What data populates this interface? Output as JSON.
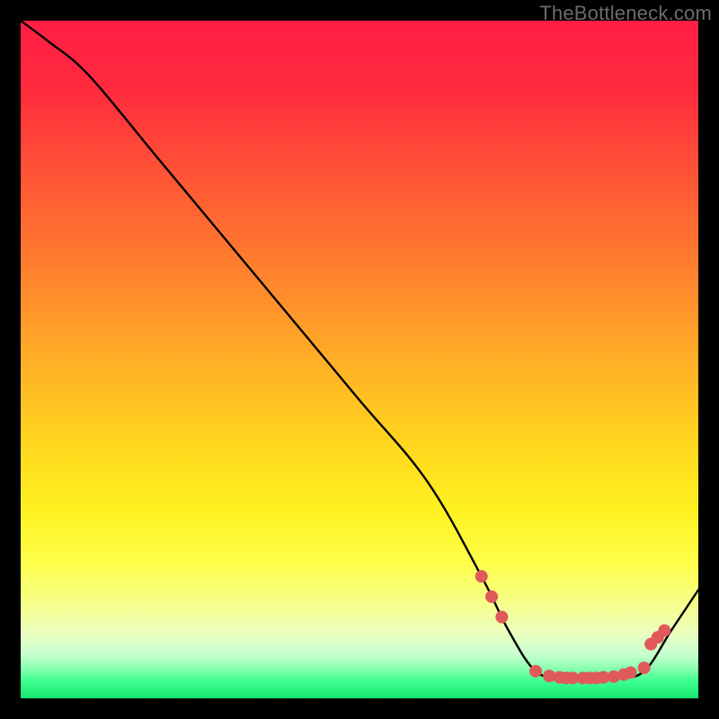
{
  "watermark": "TheBottleneck.com",
  "chart_data": {
    "type": "line",
    "title": "",
    "xlabel": "",
    "ylabel": "",
    "xlim": [
      0,
      100
    ],
    "ylim": [
      0,
      100
    ],
    "grid": false,
    "legend": false,
    "series": [
      {
        "name": "bottleneck-curve",
        "x": [
          0,
          4,
          10,
          20,
          30,
          40,
          50,
          60,
          68,
          72,
          76,
          80,
          84,
          88,
          92,
          96,
          100
        ],
        "y": [
          100,
          97,
          92,
          80,
          68,
          56,
          44,
          32,
          18,
          10,
          4,
          3,
          3,
          3,
          4,
          10,
          16
        ]
      }
    ],
    "highlight_points": {
      "name": "curve-dots",
      "x": [
        68,
        69.5,
        71,
        76,
        78,
        79.5,
        80.5,
        81.5,
        83,
        84,
        85,
        86,
        87.5,
        89,
        90,
        92,
        93,
        94,
        95
      ],
      "y": [
        18,
        15,
        12,
        4,
        3.3,
        3.1,
        3.0,
        3.0,
        3.0,
        3.0,
        3.0,
        3.1,
        3.2,
        3.5,
        3.8,
        4.5,
        8,
        9,
        10
      ]
    },
    "gradient_stops": [
      {
        "offset": 0.0,
        "color": "#ff1f44"
      },
      {
        "offset": 0.1,
        "color": "#ff2a3e"
      },
      {
        "offset": 0.22,
        "color": "#ff5236"
      },
      {
        "offset": 0.36,
        "color": "#ff7d2e"
      },
      {
        "offset": 0.5,
        "color": "#ffae26"
      },
      {
        "offset": 0.62,
        "color": "#ffd51e"
      },
      {
        "offset": 0.72,
        "color": "#fff120"
      },
      {
        "offset": 0.8,
        "color": "#feff4a"
      },
      {
        "offset": 0.86,
        "color": "#f5ff8a"
      },
      {
        "offset": 0.905,
        "color": "#eaffc0"
      },
      {
        "offset": 0.935,
        "color": "#c7ffcf"
      },
      {
        "offset": 0.955,
        "color": "#8dffb2"
      },
      {
        "offset": 0.975,
        "color": "#3dff8e"
      },
      {
        "offset": 1.0,
        "color": "#14e66f"
      }
    ],
    "curve_stroke": "#000000",
    "dot_fill": "#e05a5a",
    "dot_radius": 7
  }
}
